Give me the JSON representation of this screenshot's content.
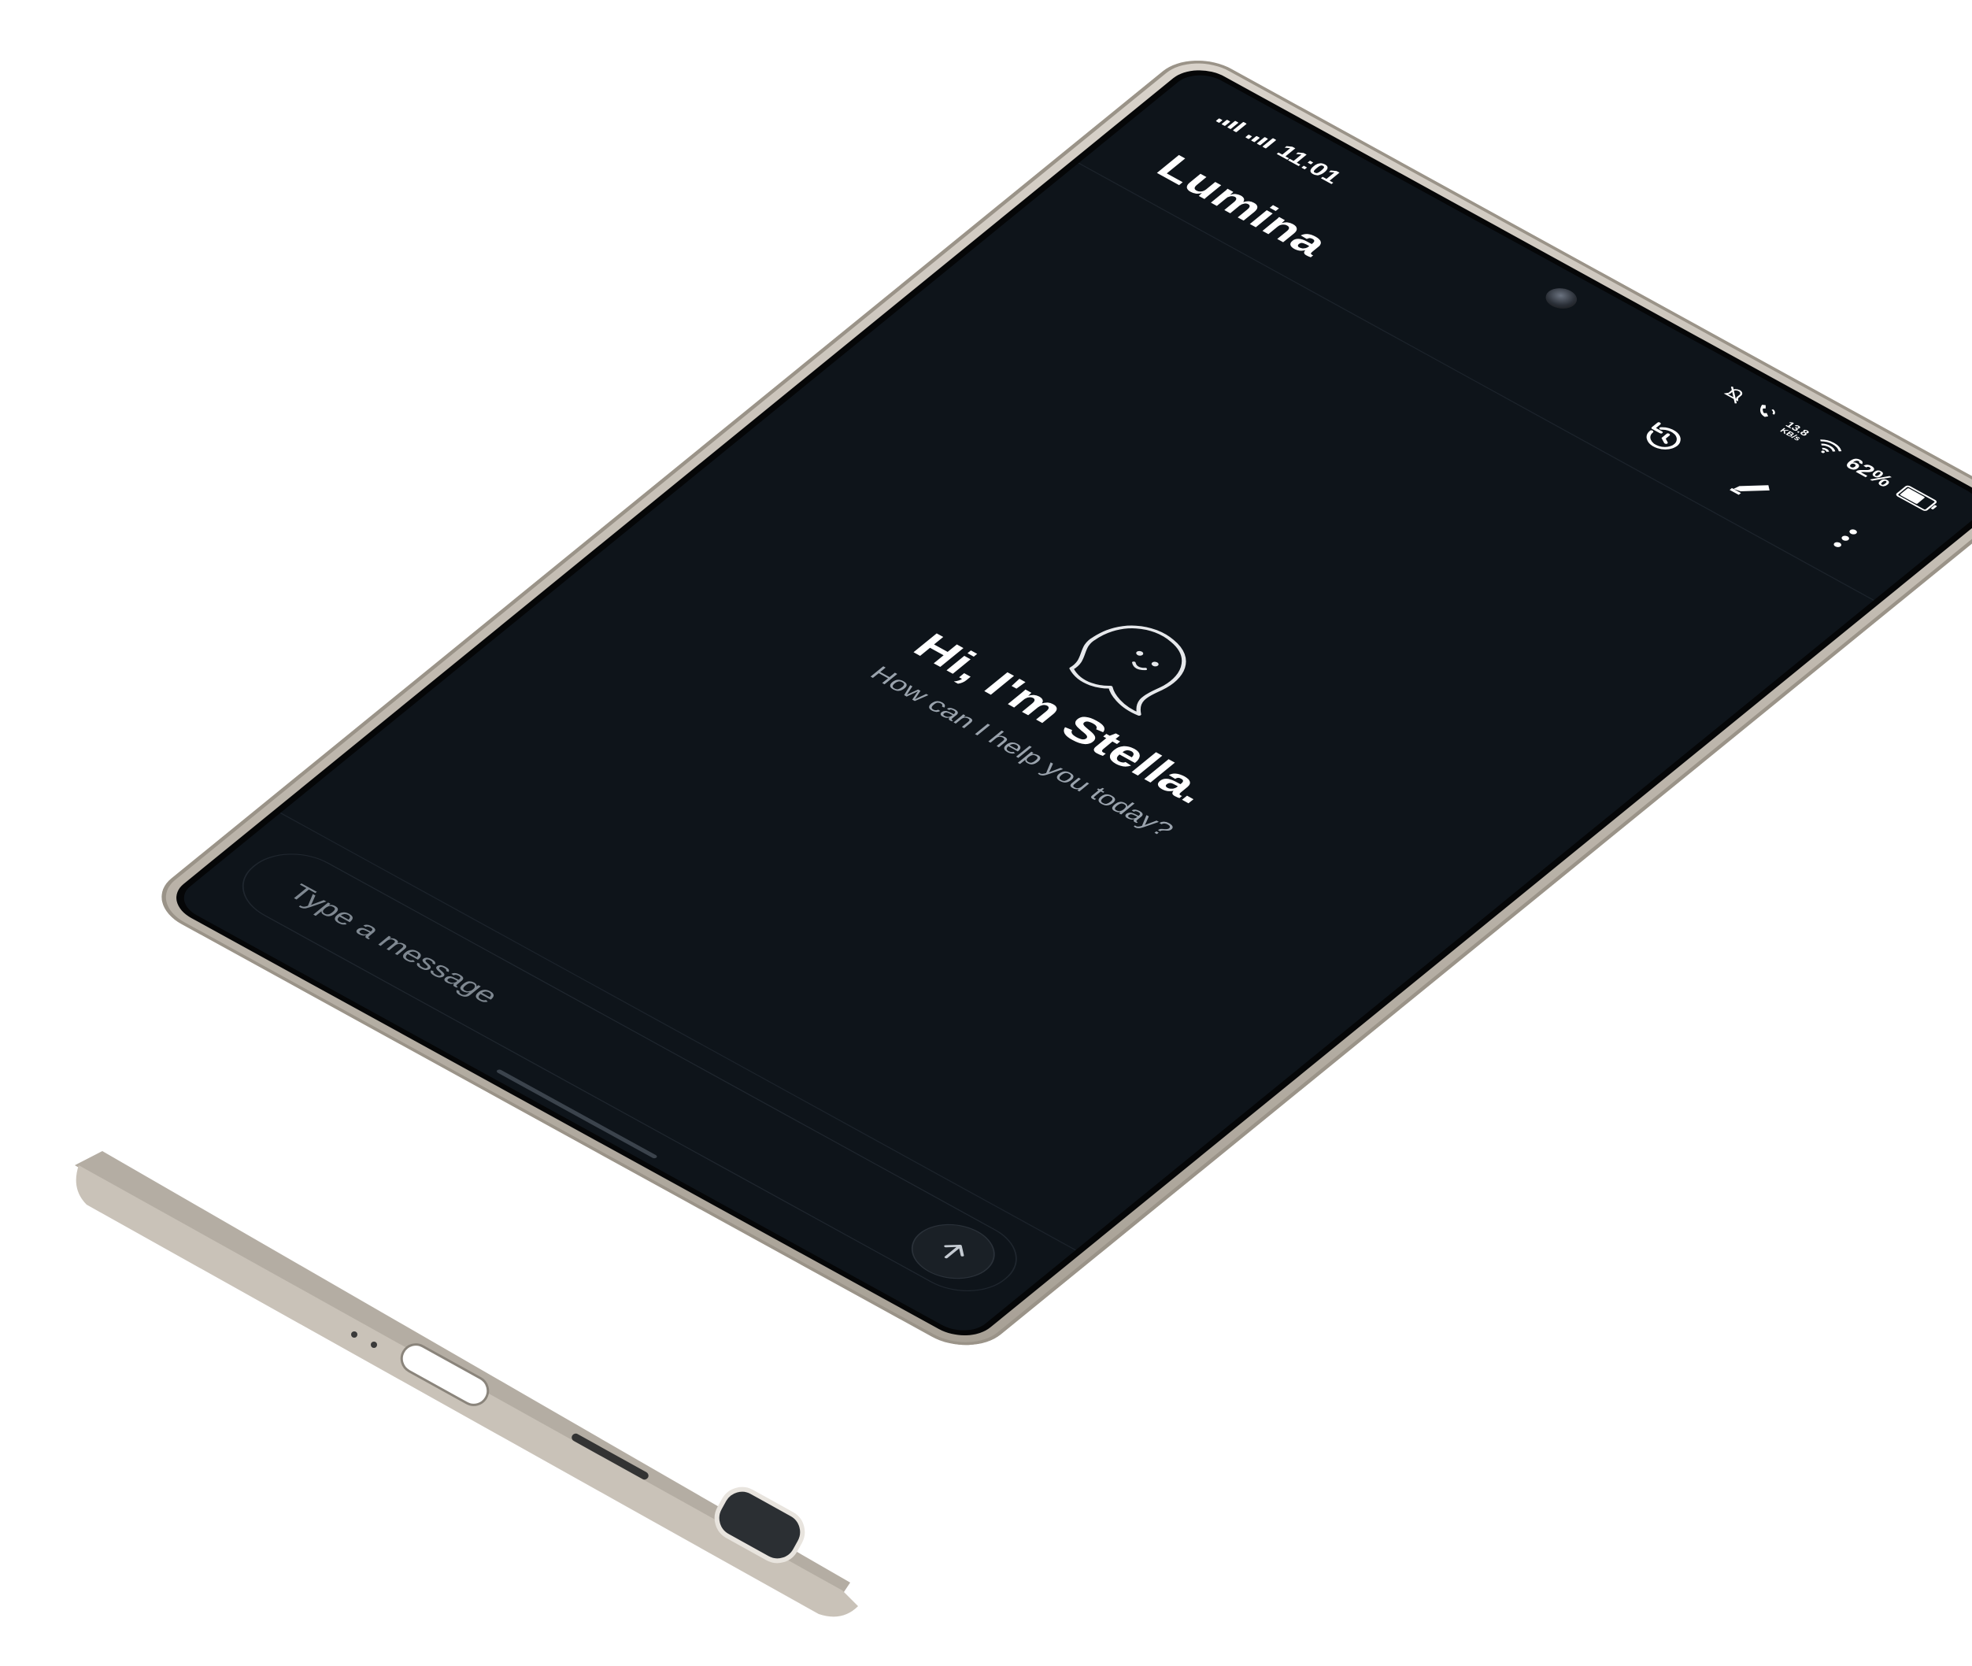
{
  "status_bar": {
    "time": "11:01",
    "netspeed_value": "13.8",
    "netspeed_unit": "KB/s",
    "battery_percent": "62%",
    "battery_level": 0.62
  },
  "header": {
    "title": "Lumina",
    "icons": [
      "history-icon",
      "edit-icon",
      "more-vert-icon"
    ]
  },
  "welcome": {
    "title": "Hi, I'm Stella.",
    "subtitle": "How can I help you today?",
    "icon": "ghost-icon"
  },
  "composer": {
    "placeholder": "Type a message",
    "send_icon": "arrow-up-icon"
  },
  "colors": {
    "background": "#0e141a",
    "text_primary": "#ffffff",
    "text_secondary": "#9aa3ad",
    "frame": "#bfb8ae"
  }
}
